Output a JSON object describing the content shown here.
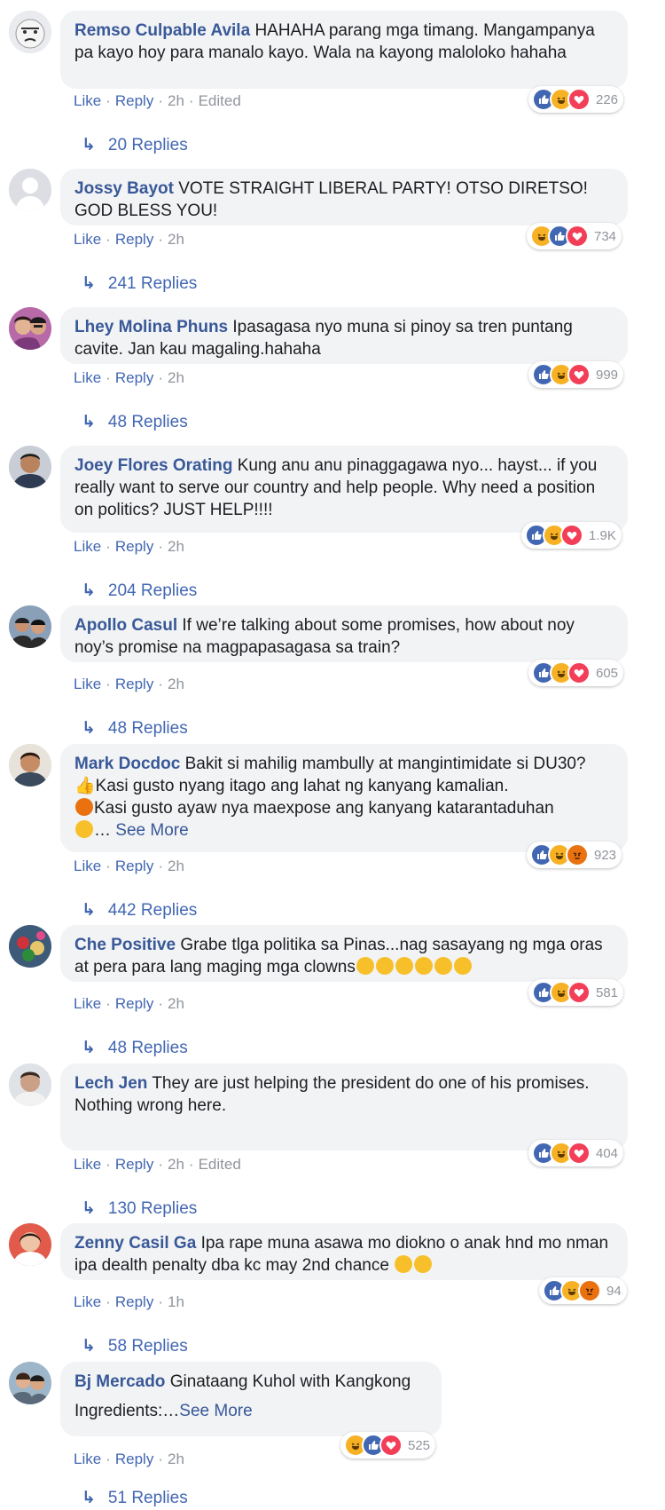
{
  "colors": {
    "author": "#385898",
    "link": "#4267b2",
    "muted": "#90949c",
    "bubble_bg": "#f2f3f5",
    "like": "#4267b2",
    "haha": "#f7b125",
    "love": "#f33e58",
    "angry": "#e9710f"
  },
  "comments": [
    {
      "author": "Remso Culpable Avila",
      "text": "HAHAHA parang mga timang. Mangampanya pa kayo hoy para manalo kayo. Wala na kayong maloloko hahaha",
      "like": "Like",
      "reply": "Reply",
      "time": "2h",
      "edited": "Edited",
      "reactions": [
        "like",
        "haha",
        "love"
      ],
      "reaction_count": "226",
      "replies": "20 Replies"
    },
    {
      "author": "Jossy Bayot",
      "text": "VOTE STRAIGHT LIBERAL PARTY! OTSO DIRETSO! GOD BLESS YOU!",
      "like": "Like",
      "reply": "Reply",
      "time": "2h",
      "reactions": [
        "haha",
        "like",
        "love"
      ],
      "reaction_count": "734",
      "replies": "241 Replies"
    },
    {
      "author": "Lhey Molina Phuns",
      "text": "Ipasagasa nyo muna si pinoy sa tren puntang cavite. Jan kau magaling.hahaha",
      "like": "Like",
      "reply": "Reply",
      "time": "2h",
      "reactions": [
        "like",
        "haha",
        "love"
      ],
      "reaction_count": "999",
      "replies": "48 Replies"
    },
    {
      "author": "Joey Flores Orating",
      "text": "Kung anu anu pinaggagawa nyo... hayst... if you really want to serve our country and help people. Why need a position on politics? JUST HELP!!!!",
      "like": "Like",
      "reply": "Reply",
      "time": "2h",
      "reactions": [
        "like",
        "haha",
        "love"
      ],
      "reaction_count": "1.9K",
      "replies": "204 Replies"
    },
    {
      "author": "Apollo Casul",
      "text": "If we’re talking about some promises, how about noy noy’s promise na magpapasagasa sa train?",
      "like": "Like",
      "reply": "Reply",
      "time": "2h",
      "reactions": [
        "like",
        "haha",
        "love"
      ],
      "reaction_count": "605",
      "replies": "48 Replies"
    },
    {
      "author": "Mark Docdoc",
      "text": "Bakit si mahilig mambully at mangintimidate si DU30?",
      "line2": "Kasi gusto nyang itago ang lahat ng kanyang kamalian.",
      "line3": "Kasi gusto ayaw nya maexpose ang kanyang katarantaduhan",
      "see_more": "See More",
      "like": "Like",
      "reply": "Reply",
      "time": "2h",
      "reactions": [
        "like",
        "haha",
        "angry"
      ],
      "reaction_count": "923",
      "replies": "442 Replies"
    },
    {
      "author": "Che Positive",
      "text": "Grabe tlga politika sa Pinas...nag sasayang ng mga oras at pera para lang maging mga clowns",
      "like": "Like",
      "reply": "Reply",
      "time": "2h",
      "reactions": [
        "like",
        "haha",
        "love"
      ],
      "reaction_count": "581",
      "replies": "48 Replies"
    },
    {
      "author": "Lech Jen",
      "text": "They are just helping the president do one of his promises.",
      "line2": "Nothing wrong here.",
      "like": "Like",
      "reply": "Reply",
      "time": "2h",
      "edited": "Edited",
      "reactions": [
        "like",
        "haha",
        "love"
      ],
      "reaction_count": "404",
      "replies": "130 Replies"
    },
    {
      "author": "Zenny Casil Ga",
      "text": "Ipa rape muna asawa mo diokno o anak hnd mo nman ipa dealth penalty dba kc may 2nd chance",
      "like": "Like",
      "reply": "Reply",
      "time": "1h",
      "reactions": [
        "like",
        "haha",
        "angry"
      ],
      "reaction_count": "94",
      "replies": "58 Replies"
    },
    {
      "author": "Bj Mercado",
      "text": "Ginataang Kuhol with Kangkong",
      "line2": "Ingredients:…",
      "see_more": "See More",
      "like": "Like",
      "reply": "Reply",
      "time": "2h",
      "reactions": [
        "haha",
        "like",
        "love"
      ],
      "reaction_count": "525",
      "replies": "51 Replies"
    }
  ]
}
